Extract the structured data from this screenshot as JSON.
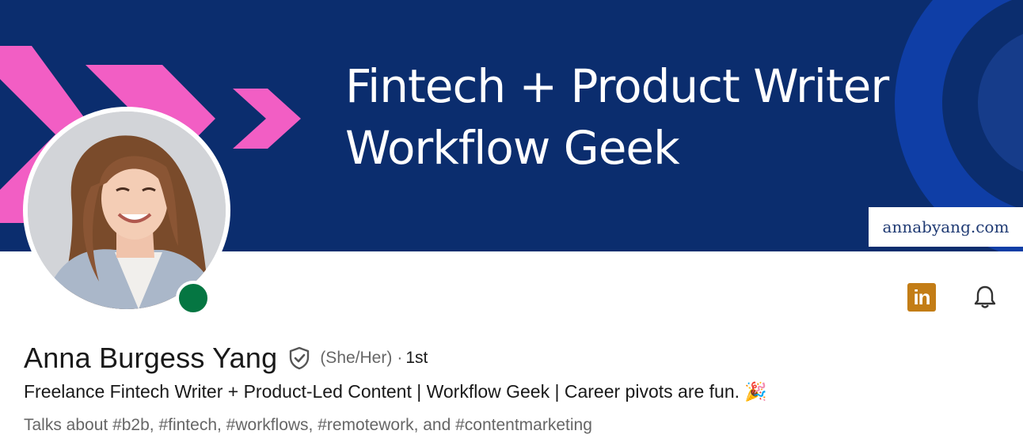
{
  "banner": {
    "title_line1": "Fintech + Product Writer",
    "title_line2": "Workflow Geek",
    "site_tag": "annabyang.com",
    "bg_color": "#0b2d6e",
    "accent_color": "#f25ec4"
  },
  "profile": {
    "name": "Anna Burgess Yang",
    "pronouns": "(She/Her)",
    "degree_separator": "·",
    "degree": "1st",
    "headline": "Freelance Fintech Writer + Product-Led Content | Workflow Geek | Career pivots are fun. 🎉",
    "talks_about": "Talks about #b2b, #fintech, #workflows, #remotework, and #contentmarketing",
    "status": "online"
  },
  "actions": {
    "linkedin_icon_label": "in",
    "linkedin_color": "#c37d16",
    "bell_icon": "bell-icon"
  }
}
